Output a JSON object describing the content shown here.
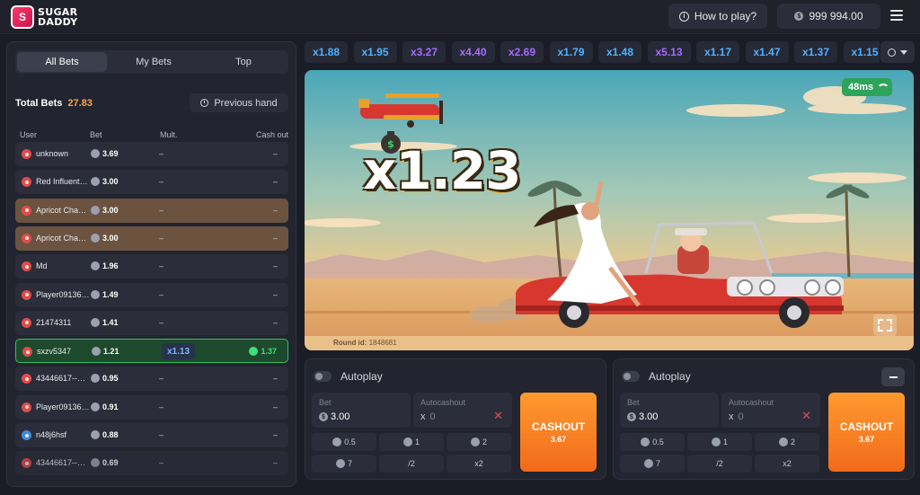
{
  "header": {
    "logo_line1": "SUGAR",
    "logo_line2": "DADDY",
    "logo_badge": "S",
    "how_to_play": "How to play?",
    "balance": "999 994.00",
    "coin_symbol": "$"
  },
  "left_panel": {
    "tabs": [
      "All Bets",
      "My Bets",
      "Top"
    ],
    "active_tab": "All Bets",
    "total_label": "Total Bets",
    "total_value": "27.83",
    "previous_hand": "Previous hand",
    "columns": {
      "user": "User",
      "bet": "Bet",
      "mult": "Mult.",
      "cashout": "Cash out"
    },
    "rows": [
      {
        "user": "unknown",
        "bet": "3.69",
        "mult": "–",
        "cashout": "–",
        "style": "normal"
      },
      {
        "user": "Red Influent…",
        "bet": "3.00",
        "mult": "–",
        "cashout": "–",
        "style": "normal"
      },
      {
        "user": "Apricot Cha…",
        "bet": "3.00",
        "mult": "–",
        "cashout": "–",
        "style": "brown"
      },
      {
        "user": "Apricot Cha…",
        "bet": "3.00",
        "mult": "–",
        "cashout": "–",
        "style": "brown"
      },
      {
        "user": "Md",
        "bet": "1.96",
        "mult": "–",
        "cashout": "–",
        "style": "normal"
      },
      {
        "user": "Player09136…",
        "bet": "1.49",
        "mult": "–",
        "cashout": "–",
        "style": "normal"
      },
      {
        "user": "21474311",
        "bet": "1.41",
        "mult": "–",
        "cashout": "–",
        "style": "normal"
      },
      {
        "user": "sxzv5347",
        "bet": "1.21",
        "mult": "x1.13",
        "cashout": "1.37",
        "style": "green"
      },
      {
        "user": "43446617--…",
        "bet": "0.95",
        "mult": "–",
        "cashout": "–",
        "style": "normal"
      },
      {
        "user": "Player09136…",
        "bet": "0.91",
        "mult": "–",
        "cashout": "–",
        "style": "normal"
      },
      {
        "user": "n48j6hsf",
        "bet": "0.88",
        "mult": "–",
        "cashout": "–",
        "style": "normal",
        "avatar": "blue"
      },
      {
        "user": "43446617--…",
        "bet": "0.69",
        "mult": "–",
        "cashout": "–",
        "style": "dim"
      }
    ]
  },
  "multiplier_history": [
    {
      "value": "x1.88",
      "color": "blue"
    },
    {
      "value": "x1.95",
      "color": "blue"
    },
    {
      "value": "x3.27",
      "color": "purple"
    },
    {
      "value": "x4.40",
      "color": "purple"
    },
    {
      "value": "x2.69",
      "color": "purple"
    },
    {
      "value": "x1.79",
      "color": "blue"
    },
    {
      "value": "x1.48",
      "color": "blue"
    },
    {
      "value": "x5.13",
      "color": "purple"
    },
    {
      "value": "x1.17",
      "color": "blue"
    },
    {
      "value": "x1.47",
      "color": "blue"
    },
    {
      "value": "x1.37",
      "color": "blue"
    },
    {
      "value": "x1.15",
      "color": "blue"
    }
  ],
  "game": {
    "current_multiplier": "x1.23",
    "ping": "48ms",
    "round_label": "Round id:",
    "round_id": "1848681",
    "colors": {
      "sky_top": "#4aa7b9",
      "sky_bottom": "#f2c98a",
      "sand": "#e8b77a",
      "car": "#d8372f"
    }
  },
  "bet_panels": [
    {
      "autoplay": "Autoplay",
      "bet_label": "Bet",
      "bet_value": "3.00",
      "autocashout_label": "Autocashout",
      "autocashout_prefix": "x",
      "autocashout_value": "0",
      "quick": [
        "0.5",
        "1",
        "2",
        "7",
        "/2",
        "x2"
      ],
      "cashout_label": "CASHOUT",
      "cashout_amount": "3.67",
      "has_minus": false
    },
    {
      "autoplay": "Autoplay",
      "bet_label": "Bet",
      "bet_value": "3.00",
      "autocashout_label": "Autocashout",
      "autocashout_prefix": "x",
      "autocashout_value": "0",
      "quick": [
        "0.5",
        "1",
        "2",
        "7",
        "/2",
        "x2"
      ],
      "cashout_label": "CASHOUT",
      "cashout_amount": "3.67",
      "has_minus": true
    }
  ]
}
